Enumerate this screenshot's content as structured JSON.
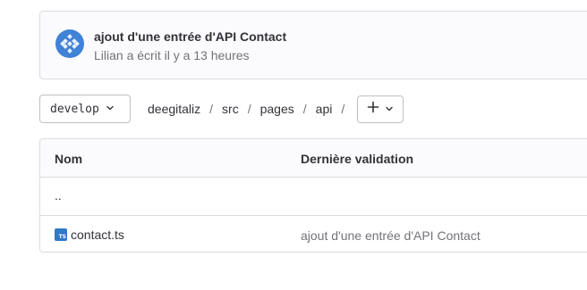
{
  "commit": {
    "title": "ajout d'une entrée d'API Contact",
    "meta": "Lilian a écrit il y a 13 heures",
    "avatar_color": "#3f82d6"
  },
  "branch": {
    "label": "develop"
  },
  "breadcrumb": [
    "deegitaliz",
    "src",
    "pages",
    "api"
  ],
  "add_button": {
    "icon": "plus-icon"
  },
  "table": {
    "headers": {
      "name": "Nom",
      "last_commit": "Dernière validation"
    },
    "parent_row": "..",
    "rows": [
      {
        "name": "contact.ts",
        "icon": "typescript-file-icon",
        "icon_label": "TS",
        "last_commit": "ajout d'une entrée d'API Contact"
      }
    ]
  },
  "colors": {
    "border": "#dcdcde",
    "text": "#333238",
    "muted": "#737278",
    "ts_blue": "#3178c6"
  }
}
